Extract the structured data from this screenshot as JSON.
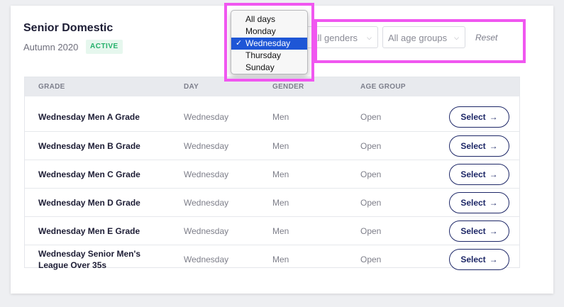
{
  "competition": {
    "title": "Senior Domestic",
    "season": "Autumn 2020",
    "status_badge": "ACTIVE"
  },
  "filters": {
    "gender": "All genders",
    "age_group": "All age groups",
    "reset_label": "Reset"
  },
  "day_dropdown": {
    "options": [
      "All days",
      "Monday",
      "Wednesday",
      "Thursday",
      "Sunday"
    ],
    "selected": "Wednesday",
    "checkmark": "✓"
  },
  "table": {
    "headers": [
      "GRADE",
      "DAY",
      "GENDER",
      "AGE GROUP"
    ],
    "rows": [
      {
        "grade": "Wednesday Men A Grade",
        "day": "Wednesday",
        "gender": "Men",
        "age_group": "Open",
        "action": "Select"
      },
      {
        "grade": "Wednesday Men B Grade",
        "day": "Wednesday",
        "gender": "Men",
        "age_group": "Open",
        "action": "Select"
      },
      {
        "grade": "Wednesday Men C Grade",
        "day": "Wednesday",
        "gender": "Men",
        "age_group": "Open",
        "action": "Select"
      },
      {
        "grade": "Wednesday Men D Grade",
        "day": "Wednesday",
        "gender": "Men",
        "age_group": "Open",
        "action": "Select"
      },
      {
        "grade": "Wednesday Men E Grade",
        "day": "Wednesday",
        "gender": "Men",
        "age_group": "Open",
        "action": "Select"
      },
      {
        "grade": "Wednesday Senior Men's League Over 35s",
        "day": "Wednesday",
        "gender": "Men",
        "age_group": "Open",
        "action": "Select"
      }
    ]
  },
  "icons": {
    "select_arrow": "→",
    "chevron": "⌵"
  },
  "colors": {
    "accent": "#1d2767",
    "badge_text": "#23b06a",
    "badge_bg": "#e6f7ee",
    "highlight": "#f057f0",
    "selection": "#1e56d6"
  }
}
